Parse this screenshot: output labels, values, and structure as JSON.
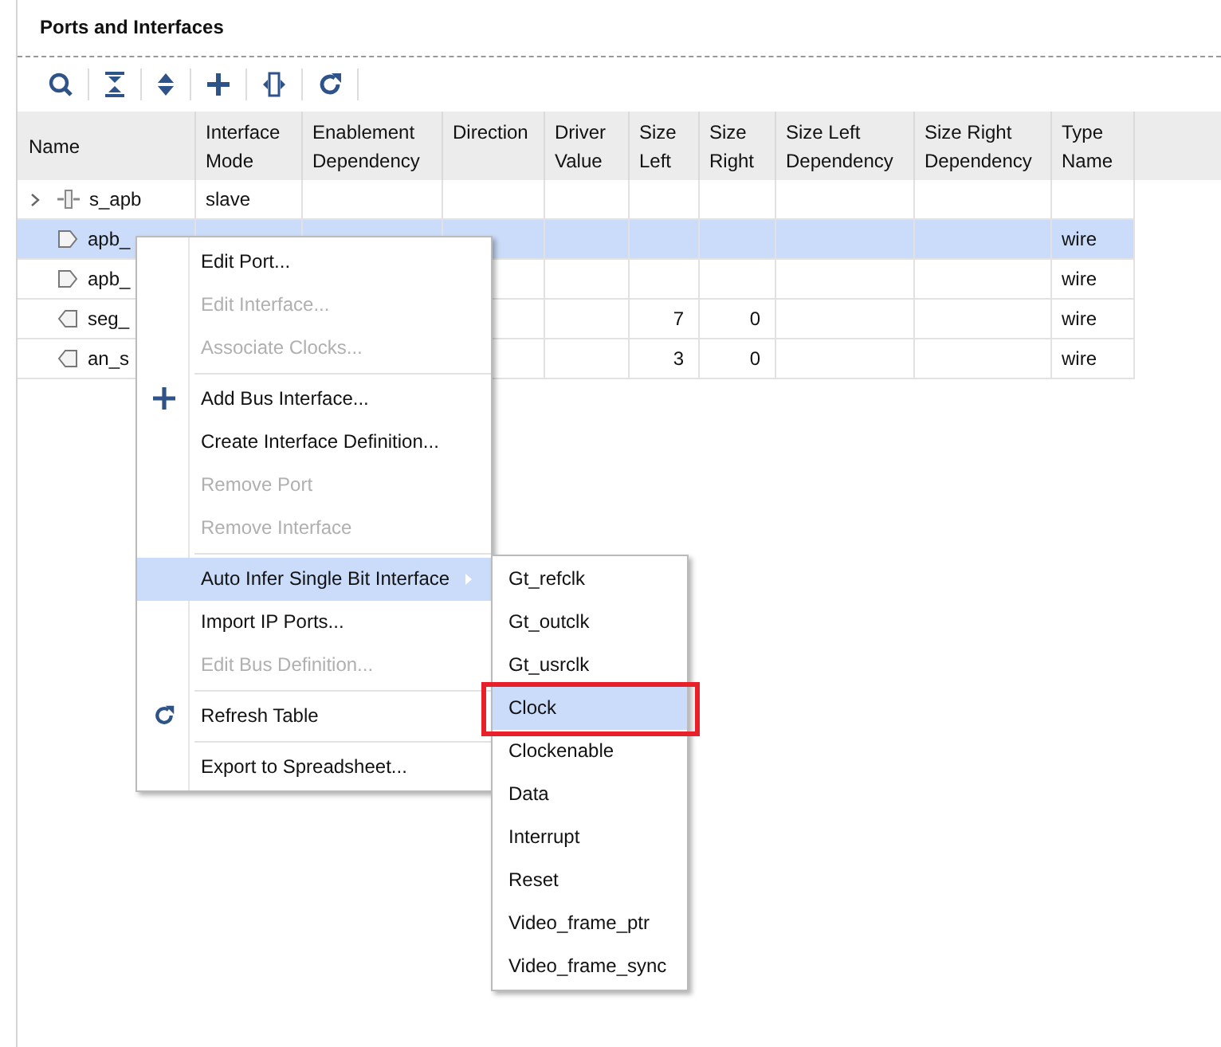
{
  "panel": {
    "title": "Ports and Interfaces"
  },
  "table": {
    "columns": [
      "Name",
      "Interface Mode",
      "Enablement Dependency",
      "Direction",
      "Driver Value",
      "Size Left",
      "Size Right",
      "Size Left Dependency",
      "Size Right Dependency",
      "Type Name"
    ],
    "rows": [
      {
        "kind": "interface",
        "expandable": true,
        "selected": false,
        "cells": [
          "s_apb",
          "slave",
          "",
          "",
          "",
          "",
          "",
          "",
          "",
          ""
        ]
      },
      {
        "kind": "input",
        "expandable": false,
        "selected": true,
        "cells": [
          "apb_",
          "",
          "",
          "",
          "",
          "",
          "",
          "",
          "",
          "wire"
        ]
      },
      {
        "kind": "input",
        "expandable": false,
        "selected": false,
        "cells": [
          "apb_",
          "",
          "",
          "",
          "",
          "",
          "",
          "",
          "",
          "wire"
        ]
      },
      {
        "kind": "output",
        "expandable": false,
        "selected": false,
        "cells": [
          "seg_",
          "",
          "",
          "",
          "",
          "7",
          "0",
          "",
          "",
          "wire"
        ]
      },
      {
        "kind": "output",
        "expandable": false,
        "selected": false,
        "cells": [
          "an_s",
          "",
          "",
          "",
          "",
          "3",
          "0",
          "",
          "",
          "wire"
        ]
      }
    ]
  },
  "context_menu": {
    "items": [
      {
        "kind": "item",
        "label": "Edit Port...",
        "disabled": false,
        "selected": false
      },
      {
        "kind": "item",
        "label": "Edit Interface...",
        "disabled": true,
        "selected": false
      },
      {
        "kind": "item",
        "label": "Associate Clocks...",
        "disabled": true,
        "selected": false
      },
      {
        "kind": "separator"
      },
      {
        "kind": "add",
        "label": "Add Bus Interface...",
        "disabled": false,
        "selected": false
      },
      {
        "kind": "item",
        "label": "Create Interface Definition...",
        "disabled": false,
        "selected": false
      },
      {
        "kind": "item",
        "label": "Remove Port",
        "disabled": true,
        "selected": false
      },
      {
        "kind": "item",
        "label": "Remove Interface",
        "disabled": true,
        "selected": false
      },
      {
        "kind": "separator"
      },
      {
        "kind": "submenu",
        "label": "Auto Infer Single Bit Interface",
        "disabled": false,
        "selected": true
      },
      {
        "kind": "item",
        "label": "Import IP Ports...",
        "disabled": false,
        "selected": false
      },
      {
        "kind": "item",
        "label": "Edit Bus Definition...",
        "disabled": true,
        "selected": false
      },
      {
        "kind": "separator"
      },
      {
        "kind": "refresh",
        "label": "Refresh Table",
        "disabled": false,
        "selected": false
      },
      {
        "kind": "separator"
      },
      {
        "kind": "item",
        "label": "Export to Spreadsheet...",
        "disabled": false,
        "selected": false
      }
    ]
  },
  "submenu": {
    "items": [
      {
        "label": "Gt_refclk",
        "selected": false,
        "outlined": false
      },
      {
        "label": "Gt_outclk",
        "selected": false,
        "outlined": false
      },
      {
        "label": "Gt_usrclk",
        "selected": false,
        "outlined": false
      },
      {
        "label": "Clock",
        "selected": true,
        "outlined": true
      },
      {
        "label": "Clockenable",
        "selected": false,
        "outlined": false
      },
      {
        "label": "Data",
        "selected": false,
        "outlined": false
      },
      {
        "label": "Interrupt",
        "selected": false,
        "outlined": false
      },
      {
        "label": "Reset",
        "selected": false,
        "outlined": false
      },
      {
        "label": "Video_frame_ptr",
        "selected": false,
        "outlined": false
      },
      {
        "label": "Video_frame_sync",
        "selected": false,
        "outlined": false
      }
    ]
  }
}
